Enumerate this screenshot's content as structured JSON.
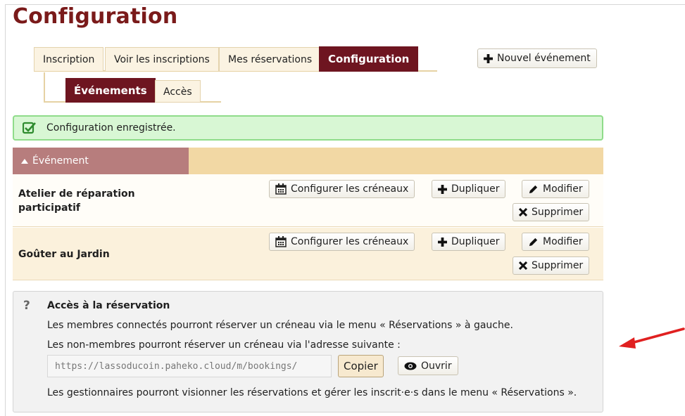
{
  "page": {
    "title": "Configuration"
  },
  "tabs": [
    {
      "label": "Inscription"
    },
    {
      "label": "Voir les inscriptions"
    },
    {
      "label": "Mes réservations"
    },
    {
      "label": "Configuration"
    }
  ],
  "new_event_button": "Nouvel événement",
  "subtabs": [
    {
      "label": "Événements"
    },
    {
      "label": "Accès"
    }
  ],
  "alert": {
    "message": "Configuration enregistrée.",
    "color": "#d8f7d4"
  },
  "table": {
    "header": "Événement",
    "actions": {
      "configure": "Configurer les créneaux",
      "duplicate": "Dupliquer",
      "edit": "Modifier",
      "delete": "Supprimer"
    },
    "rows": [
      {
        "line1": "Atelier de réparation",
        "line2": "participatif"
      },
      {
        "line1": "Goûter au Jardin",
        "line2": ""
      }
    ]
  },
  "help": {
    "icon": "?",
    "title": "Accès à la réservation",
    "line1": "Les membres connectés pourront réserver un créneau via le menu « Réservations » à gauche.",
    "line2": "Les non-membres pourront réserver un créneau via l'adresse suivante :",
    "url": "https://lassoducoin.paheko.cloud/m/bookings/",
    "copy_button": "Copier",
    "open_button": "Ouvrir",
    "line3": "Les gestionnaires pourront visionner les réservations et gérer les inscrit·e·s dans le menu « Réservations »."
  },
  "colors": {
    "brand": "#6e1520",
    "title": "#7a1a1a",
    "annotation_arrow": "#e02020"
  }
}
